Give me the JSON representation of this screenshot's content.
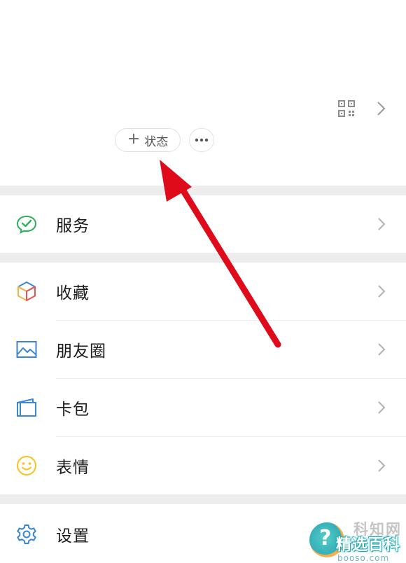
{
  "header": {
    "qr_icon": "qr-code-icon",
    "status_button": {
      "plus": "+",
      "label": "状态"
    },
    "more_icon": "more-dots-icon"
  },
  "menu": {
    "items": [
      {
        "label": "服务",
        "icon": "wechat-pay-icon",
        "color": "#2bb05a"
      },
      {
        "label": "收藏",
        "icon": "favorites-cube-icon",
        "color": "#f5b53c"
      },
      {
        "label": "朋友圈",
        "icon": "moments-picture-icon",
        "color": "#3a86d6"
      },
      {
        "label": "卡包",
        "icon": "card-wallet-icon",
        "color": "#3a86d6"
      },
      {
        "label": "表情",
        "icon": "smiley-icon",
        "color": "#f6c21c"
      },
      {
        "label": "设置",
        "icon": "settings-gear-icon",
        "color": "#3a86d6"
      }
    ]
  },
  "annotation": {
    "arrow_color": "#e00b1a"
  },
  "watermark": {
    "top": "科知网",
    "main": "精选百科",
    "url": "booso.com"
  }
}
